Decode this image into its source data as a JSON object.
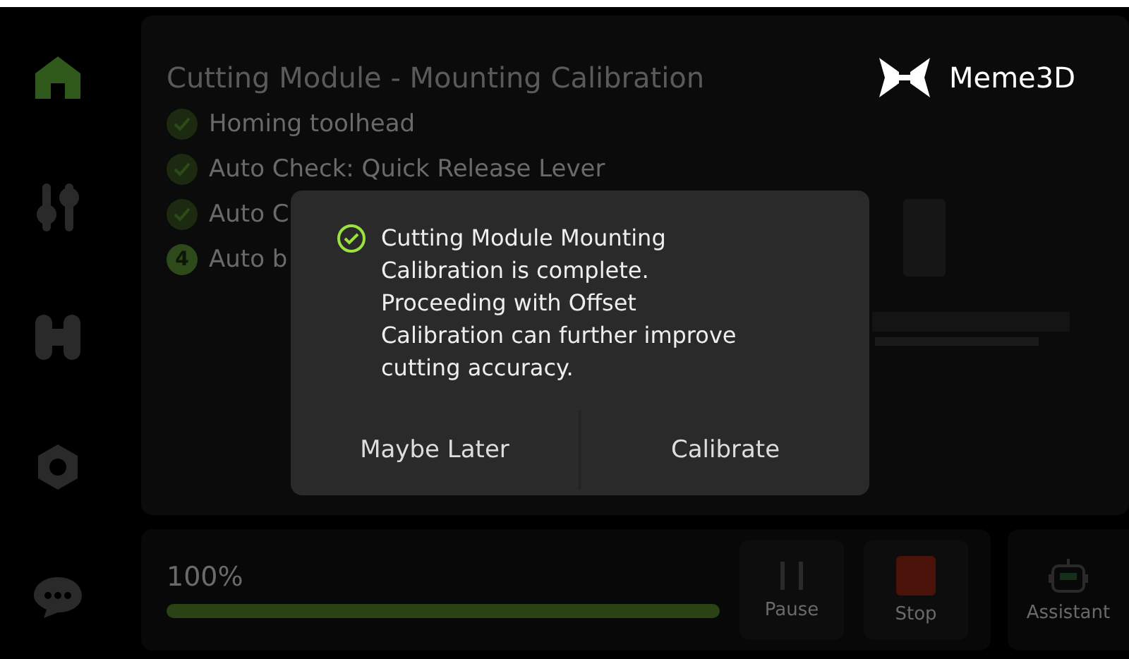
{
  "sidebar": {
    "items": [
      {
        "kind": "home",
        "selected": true
      },
      {
        "kind": "tune",
        "selected": false
      },
      {
        "kind": "filament",
        "selected": false
      },
      {
        "kind": "settings",
        "selected": false
      },
      {
        "kind": "chat",
        "selected": false
      }
    ]
  },
  "header": {
    "title": "Cutting Module - Mounting Calibration",
    "brand": "Meme3D"
  },
  "steps": [
    {
      "text": "Homing toolhead",
      "done": true
    },
    {
      "text": "Auto Check: Quick Release Lever",
      "done": true
    },
    {
      "text": "Auto C",
      "done": true
    },
    {
      "text": "Auto b",
      "done": false,
      "number": "4"
    }
  ],
  "job": {
    "reading": "100%",
    "level": 1,
    "controls": [
      {
        "kind": "pause",
        "label": "Pause"
      },
      {
        "kind": "stop",
        "label": "Stop"
      }
    ],
    "assistant": "Assistant"
  },
  "dialog": {
    "message": "Cutting Module Mounting Calibration is complete. Proceeding with Offset Calibration can further improve cutting accuracy.",
    "buttons": [
      "Maybe Later",
      "Calibrate"
    ]
  }
}
